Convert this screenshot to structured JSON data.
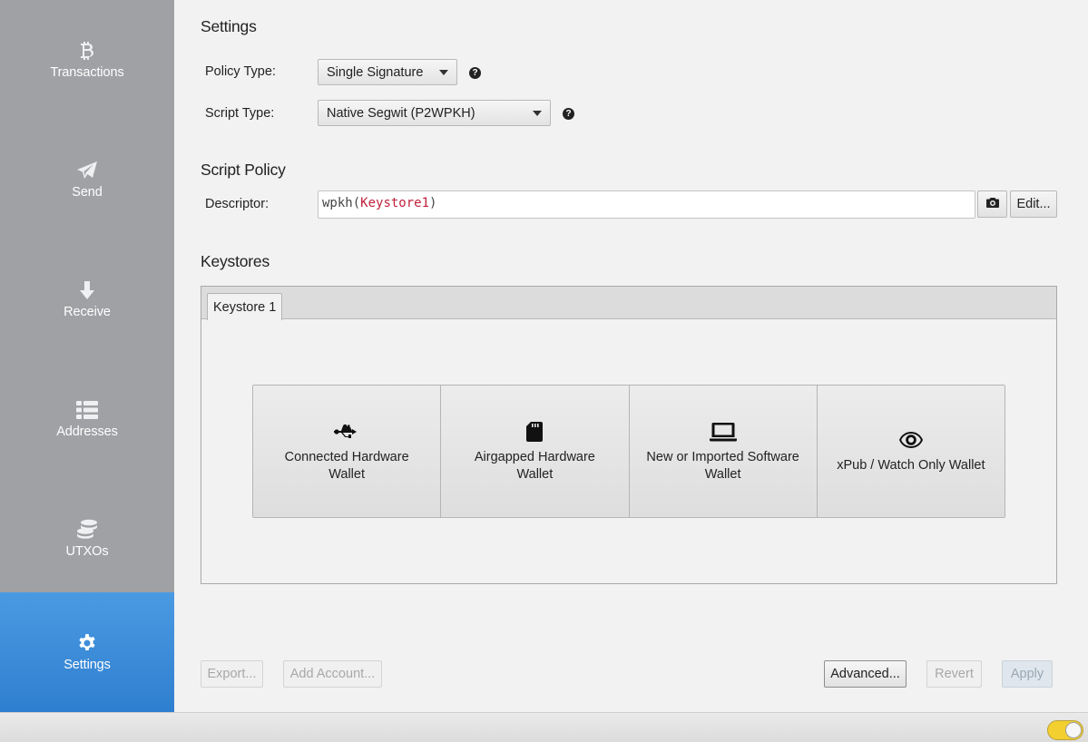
{
  "sidebar": {
    "items": [
      {
        "label": "Transactions",
        "icon": "bitcoin-icon"
      },
      {
        "label": "Send",
        "icon": "paper-plane-icon"
      },
      {
        "label": "Receive",
        "icon": "arrow-down-icon"
      },
      {
        "label": "Addresses",
        "icon": "list-icon"
      },
      {
        "label": "UTXOs",
        "icon": "coins-icon"
      },
      {
        "label": "Settings",
        "icon": "gear-icon",
        "active": true
      }
    ]
  },
  "settings": {
    "title": "Settings",
    "policy_type_label": "Policy Type:",
    "policy_type_value": "Single Signature",
    "script_type_label": "Script Type:",
    "script_type_value": "Native Segwit (P2WPKH)",
    "help_glyph": "?"
  },
  "script_policy": {
    "title": "Script Policy",
    "descriptor_label": "Descriptor:",
    "descriptor_prefix": "wpkh(",
    "descriptor_keyword": "Keystore1",
    "descriptor_suffix": ")",
    "edit_label": "Edit..."
  },
  "keystores": {
    "title": "Keystores",
    "tabs": [
      {
        "label": "Keystore 1"
      }
    ],
    "options": [
      {
        "label": "Connected Hardware Wallet",
        "icon": "usb-icon"
      },
      {
        "label": "Airgapped Hardware Wallet",
        "icon": "sd-card-icon"
      },
      {
        "label": "New or Imported Software Wallet",
        "icon": "laptop-icon"
      },
      {
        "label": "xPub / Watch Only Wallet",
        "icon": "eye-icon"
      }
    ]
  },
  "actions": {
    "export": "Export...",
    "add_account": "Add Account...",
    "advanced": "Advanced...",
    "revert": "Revert",
    "apply": "Apply"
  },
  "colors": {
    "sidebar": "#9fa1a4",
    "active_nav": "#3a8ad8",
    "descriptor_keyword": "#c0223b",
    "toggle": "#f3cf2f"
  }
}
